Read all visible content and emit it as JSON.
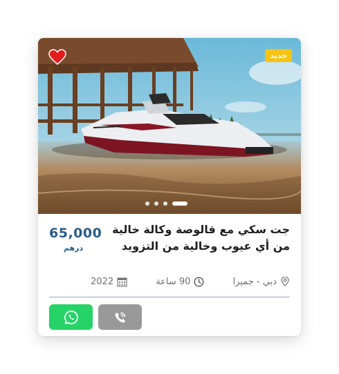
{
  "listing": {
    "badge": "جديد",
    "title_line1": "جت سكي مع قالوصة وكالة خالية",
    "title_line2": "من أي عيوب وخالية من التزويد",
    "price": "65,000",
    "currency": "درهم",
    "location": "دبي - جميرا",
    "duration": "90 ساعة",
    "year": "2022",
    "photo_count": 4,
    "active_photo": 4
  },
  "icons": {
    "favorite": "heart-icon",
    "location": "map-pin-icon",
    "duration": "clock-icon",
    "year": "calendar-icon",
    "whatsapp": "whatsapp-icon",
    "call": "phone-icon"
  },
  "colors": {
    "price": "#2a5b8a",
    "badge": "#f6c312",
    "favorite": "#e41b1b",
    "whatsapp": "#26d367",
    "call": "#999999",
    "divider": "#8aa3c4"
  }
}
